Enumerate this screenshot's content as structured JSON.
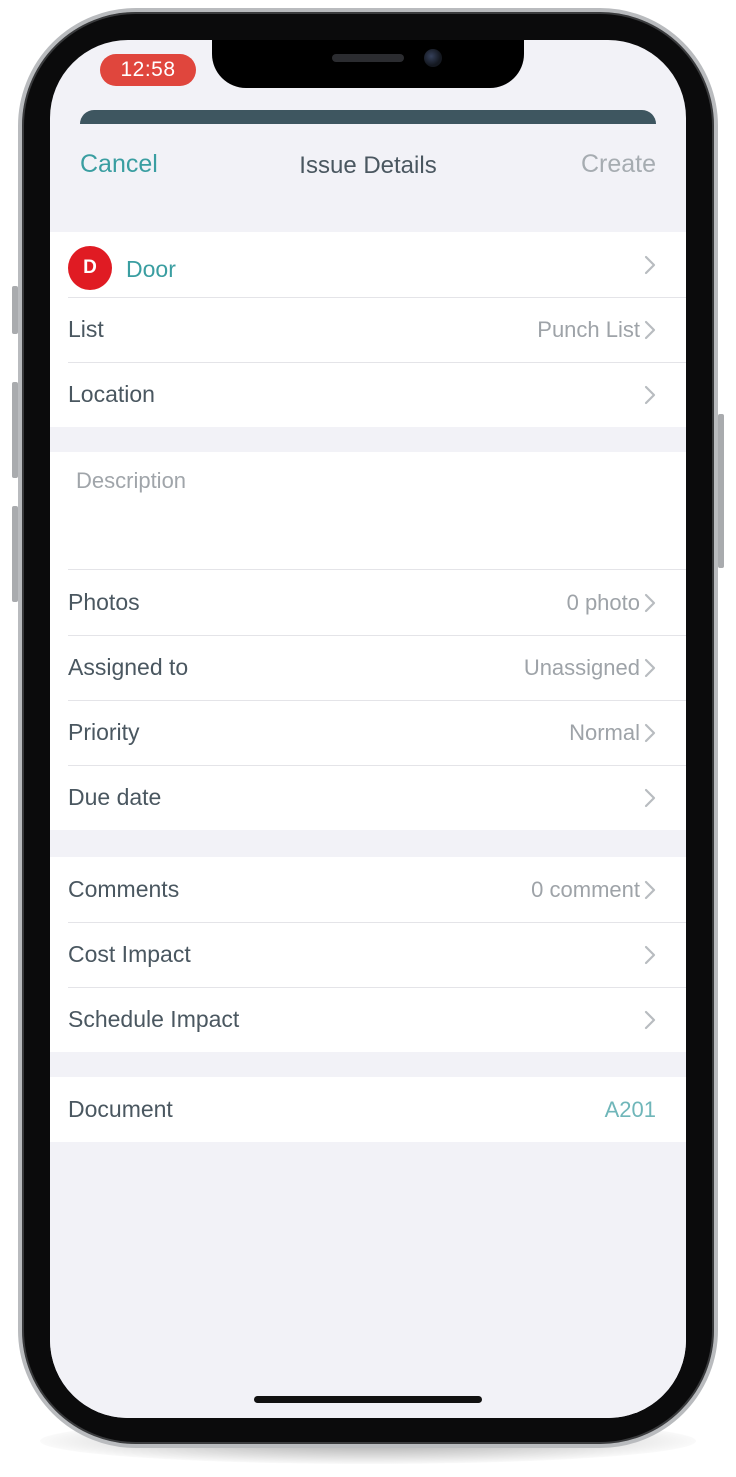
{
  "status_bar": {
    "time": "12:58"
  },
  "nav": {
    "cancel": "Cancel",
    "title": "Issue Details",
    "create": "Create"
  },
  "issue_type": {
    "badge": "D",
    "label": "Door"
  },
  "list": {
    "label": "List",
    "value": "Punch List"
  },
  "location": {
    "label": "Location",
    "value": ""
  },
  "description": {
    "placeholder": "Description"
  },
  "photos": {
    "label": "Photos",
    "value": "0 photo"
  },
  "assigned_to": {
    "label": "Assigned to",
    "value": "Unassigned"
  },
  "priority": {
    "label": "Priority",
    "value": "Normal"
  },
  "due_date": {
    "label": "Due date",
    "value": ""
  },
  "comments": {
    "label": "Comments",
    "value": "0 comment"
  },
  "cost_impact": {
    "label": "Cost Impact",
    "value": ""
  },
  "schedule_impact": {
    "label": "Schedule Impact",
    "value": ""
  },
  "document": {
    "label": "Document",
    "value": "A201"
  },
  "icons": {
    "chevron": "chevron-right-icon",
    "badge": "issue-type-badge"
  },
  "colors": {
    "accent": "#3a9ea1",
    "badge": "#e01b23",
    "status_pill": "#e0463d",
    "sheet_header": "#3e5660",
    "background": "#f2f2f7"
  }
}
